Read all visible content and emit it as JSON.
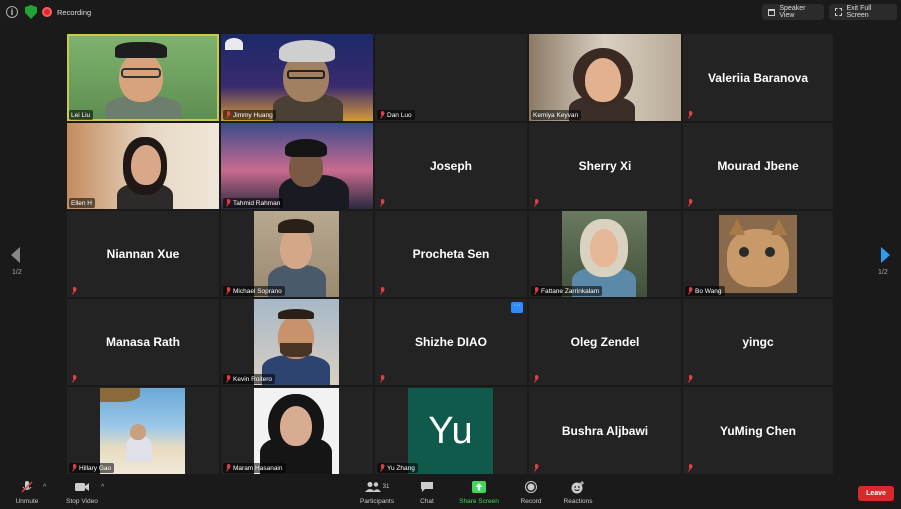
{
  "top_bar": {
    "recording_label": "Recording",
    "speaker_view_label": "Speaker View",
    "exit_full_screen_label": "Exit Full Screen"
  },
  "pagination": {
    "left_page": "1/2",
    "right_page": "1/2"
  },
  "participants": [
    {
      "name": "Lei Liu",
      "type": "video",
      "active": true
    },
    {
      "name": "Jimmy Huang",
      "type": "video",
      "muted": true
    },
    {
      "name": "Dan Luo",
      "type": "blank",
      "muted": true
    },
    {
      "name": "Kemiya Keyvan",
      "type": "video"
    },
    {
      "name": "Valeriia Baranova",
      "type": "name",
      "muted": true
    },
    {
      "name": "Ellen H",
      "type": "video"
    },
    {
      "name": "Tahmid Rahman",
      "type": "video",
      "muted": true
    },
    {
      "name": "Joseph",
      "type": "name",
      "muted": true
    },
    {
      "name": "Sherry Xi",
      "type": "name",
      "muted": true
    },
    {
      "name": "Mourad Jbene",
      "type": "name",
      "muted": true
    },
    {
      "name": "Niannan Xue",
      "type": "name",
      "muted": true
    },
    {
      "name": "Michael Soprano",
      "type": "video",
      "muted": true
    },
    {
      "name": "Procheta Sen",
      "type": "name",
      "muted": true
    },
    {
      "name": "Fattane Zarrinkalam",
      "type": "video",
      "muted": true
    },
    {
      "name": "Bo Wang",
      "type": "video",
      "muted": true
    },
    {
      "name": "Manasa Rath",
      "type": "name",
      "muted": true
    },
    {
      "name": "Kevin Roitero",
      "type": "video",
      "muted": true
    },
    {
      "name": "Shizhe DIAO",
      "type": "name",
      "muted": true
    },
    {
      "name": "Oleg Zendel",
      "type": "name",
      "muted": true
    },
    {
      "name": "yingc",
      "type": "name",
      "muted": true
    },
    {
      "name": "Hillary Gao",
      "type": "video",
      "muted": true
    },
    {
      "name": "Maram Hasanain",
      "type": "video",
      "muted": true
    },
    {
      "name": "Yu Zhang",
      "type": "avatar",
      "avatar_text": "Yu",
      "muted": true
    },
    {
      "name": "Bushra Aljbawi",
      "type": "name",
      "muted": true
    },
    {
      "name": "YuMing Chen",
      "type": "name",
      "muted": true
    }
  ],
  "more_badge": "···",
  "toolbar": {
    "unmute_label": "Unmute",
    "stop_video_label": "Stop Video",
    "participants_label": "Participants",
    "participants_count": "31",
    "chat_label": "Chat",
    "share_screen_label": "Share Screen",
    "record_label": "Record",
    "reactions_label": "Reactions",
    "leave_label": "Leave"
  },
  "colors": {
    "active_speaker_border": "#c9c94c",
    "share_screen_green": "#3fd85a",
    "leave_red": "#d82a2a",
    "nav_blue": "#2a9df4",
    "yu_avatar_bg": "#0f5a4a"
  }
}
